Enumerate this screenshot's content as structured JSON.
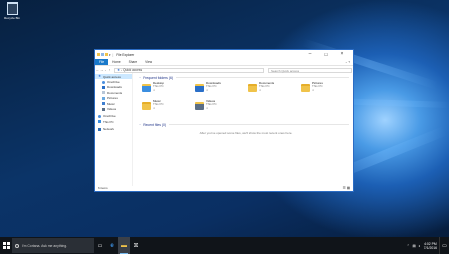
{
  "desktop": {
    "recycle_bin_label": "Recycle Bin"
  },
  "window": {
    "title": "File Explorer",
    "ribbon_tabs": [
      "File",
      "Home",
      "Share",
      "View"
    ],
    "address_path": "Quick access",
    "search_placeholder": "Search Quick access",
    "nav_items": [
      {
        "label": "Quick access",
        "icon": "star-icon",
        "selected": true
      },
      {
        "label": "OneDrive",
        "icon": "cloud-icon"
      },
      {
        "label": "Downloads",
        "icon": "download-icon"
      },
      {
        "label": "Documents",
        "icon": "document-icon"
      },
      {
        "label": "Pictures",
        "icon": "picture-icon"
      },
      {
        "label": "Music",
        "icon": "music-icon"
      },
      {
        "label": "Videos",
        "icon": "video-icon"
      },
      {
        "label": "OneDrive",
        "icon": "cloud-icon"
      },
      {
        "label": "This PC",
        "icon": "computer-icon"
      },
      {
        "label": "Network",
        "icon": "network-icon"
      }
    ],
    "frequent_header": "Frequent folders (6)",
    "folders": [
      {
        "name": "Desktop",
        "location": "This PC",
        "color": "#3b8ee0"
      },
      {
        "name": "Downloads",
        "location": "This PC",
        "color": "#2a6fc8"
      },
      {
        "name": "Documents",
        "location": "This PC",
        "color": "#f0c34a"
      },
      {
        "name": "Pictures",
        "location": "This PC",
        "color": "#f0c34a"
      },
      {
        "name": "Music",
        "location": "This PC",
        "color": "#f0c34a"
      },
      {
        "name": "Videos",
        "location": "This PC",
        "color": "#f0c34a"
      }
    ],
    "recent_header": "Recent files (0)",
    "recent_empty": "After you've opened some files, we'll show the most recent ones here.",
    "status": "6 items"
  },
  "taskbar": {
    "search_placeholder": "I'm Cortana. Ask me anything.",
    "clock_time": "4:02 PM",
    "clock_date": "7/1/2016",
    "accent": "#76b9ed"
  }
}
